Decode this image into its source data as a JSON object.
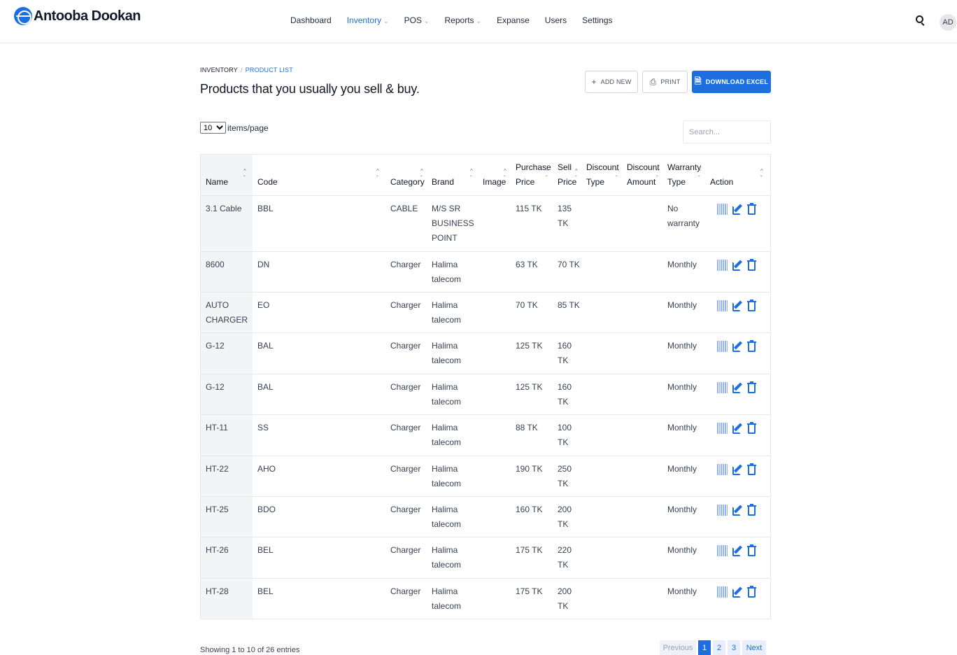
{
  "header": {
    "brand": "Antooba Dookan",
    "nav": [
      {
        "label": "Dashboard",
        "caret": ""
      },
      {
        "label": "Inventory",
        "caret": "⌄"
      },
      {
        "label": "POS",
        "caret": "⌄"
      },
      {
        "label": "Reports",
        "caret": "⌄"
      },
      {
        "label": "Expanse",
        "caret": ""
      },
      {
        "label": "Users",
        "caret": ""
      },
      {
        "label": "Settings",
        "caret": ""
      }
    ],
    "avatar": "AD"
  },
  "breadcrumb": {
    "root": "INVENTORY",
    "separator": "/",
    "current": "PRODUCT LIST"
  },
  "page_title": "Products that you usually you sell & buy.",
  "actions": {
    "add_new": "ADD NEW",
    "print": "PRINT",
    "download_excel": "DOWNLOAD EXCEL"
  },
  "controls": {
    "page_size": "10",
    "page_size_label": "items/page",
    "search_placeholder": "Search..."
  },
  "table": {
    "columns": [
      {
        "line1": "",
        "line2": "Name"
      },
      {
        "line1": "",
        "line2": "Code"
      },
      {
        "line1": "",
        "line2": "Category"
      },
      {
        "line1": "",
        "line2": "Brand"
      },
      {
        "line1": "",
        "line2": "Image"
      },
      {
        "line1": "Purchase",
        "line2": "Price"
      },
      {
        "line1": "Sell",
        "line2": "Price"
      },
      {
        "line1": "Discount",
        "line2": "Type"
      },
      {
        "line1": "Discount",
        "line2": "Amount"
      },
      {
        "line1": "Warranty",
        "line2": "Type"
      },
      {
        "line1": "",
        "line2": "Action"
      }
    ],
    "rows": [
      {
        "name": [
          "3.1 Cable"
        ],
        "code": "BBL",
        "category": "CABLE",
        "brand": [
          "M/S SR",
          "BUSINESS",
          "POINT"
        ],
        "purchase": "115 TK",
        "sell": [
          "135",
          "TK"
        ],
        "discount_type": "",
        "discount_amount": "",
        "warranty": [
          "No",
          "warranty"
        ]
      },
      {
        "name": [
          "8600"
        ],
        "code": "DN",
        "category": "Charger",
        "brand": [
          "Halima",
          "talecom"
        ],
        "purchase": "63 TK",
        "sell": [
          "70 TK"
        ],
        "discount_type": "",
        "discount_amount": "",
        "warranty": [
          "Monthly"
        ]
      },
      {
        "name": [
          "AUTO",
          "CHARGER"
        ],
        "code": "EO",
        "category": "Charger",
        "brand": [
          "Halima",
          "talecom"
        ],
        "purchase": "70 TK",
        "sell": [
          "85 TK"
        ],
        "discount_type": "",
        "discount_amount": "",
        "warranty": [
          "Monthly"
        ]
      },
      {
        "name": [
          "G-12"
        ],
        "code": "BAL",
        "category": "Charger",
        "brand": [
          "Halima",
          "talecom"
        ],
        "purchase": "125 TK",
        "sell": [
          "160",
          "TK"
        ],
        "discount_type": "",
        "discount_amount": "",
        "warranty": [
          "Monthly"
        ]
      },
      {
        "name": [
          "G-12"
        ],
        "code": "BAL",
        "category": "Charger",
        "brand": [
          "Halima",
          "talecom"
        ],
        "purchase": "125 TK",
        "sell": [
          "160",
          "TK"
        ],
        "discount_type": "",
        "discount_amount": "",
        "warranty": [
          "Monthly"
        ]
      },
      {
        "name": [
          "HT-11"
        ],
        "code": "SS",
        "category": "Charger",
        "brand": [
          "Halima",
          "talecom"
        ],
        "purchase": "88 TK",
        "sell": [
          "100",
          "TK"
        ],
        "discount_type": "",
        "discount_amount": "",
        "warranty": [
          "Monthly"
        ]
      },
      {
        "name": [
          "HT-22"
        ],
        "code": "AHO",
        "category": "Charger",
        "brand": [
          "Halima",
          "talecom"
        ],
        "purchase": "190 TK",
        "sell": [
          "250",
          "TK"
        ],
        "discount_type": "",
        "discount_amount": "",
        "warranty": [
          "Monthly"
        ]
      },
      {
        "name": [
          "HT-25"
        ],
        "code": "BDO",
        "category": "Charger",
        "brand": [
          "Halima",
          "talecom"
        ],
        "purchase": "160 TK",
        "sell": [
          "200",
          "TK"
        ],
        "discount_type": "",
        "discount_amount": "",
        "warranty": [
          "Monthly"
        ]
      },
      {
        "name": [
          "HT-26"
        ],
        "code": "BEL",
        "category": "Charger",
        "brand": [
          "Halima",
          "talecom"
        ],
        "purchase": "175 TK",
        "sell": [
          "220",
          "TK"
        ],
        "discount_type": "",
        "discount_amount": "",
        "warranty": [
          "Monthly"
        ]
      },
      {
        "name": [
          "HT-28"
        ],
        "code": "BEL",
        "category": "Charger",
        "brand": [
          "Halima",
          "talecom"
        ],
        "purchase": "175 TK",
        "sell": [
          "200",
          "TK"
        ],
        "discount_type": "",
        "discount_amount": "",
        "warranty": [
          "Monthly"
        ]
      }
    ]
  },
  "footer": {
    "entries_info": "Showing 1 to 10 of 26 entries",
    "pagination": {
      "previous": "Previous",
      "pages": [
        "1",
        "2",
        "3"
      ],
      "current": "1",
      "next": "Next"
    }
  },
  "colors": {
    "accent": "#1d6fe0",
    "barcode": "#93b4f0",
    "name_col_bg": "#f3f4f6",
    "border": "#e5e7eb"
  }
}
